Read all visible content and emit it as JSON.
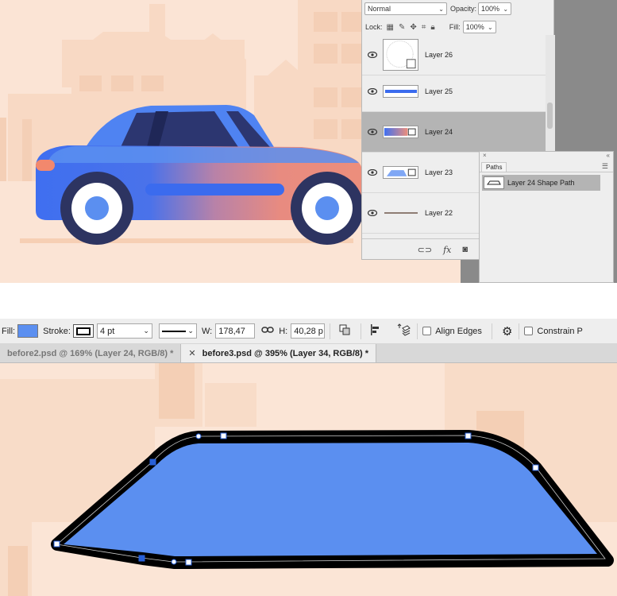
{
  "layers_panel": {
    "blend_mode": "Normal",
    "opacity_label": "Opacity:",
    "opacity_value": "100%",
    "lock_label": "Lock:",
    "fill_label": "Fill:",
    "fill_value": "100%",
    "layers": [
      {
        "name": "Layer 26",
        "selected": false
      },
      {
        "name": "Layer 25",
        "selected": false
      },
      {
        "name": "Layer 24",
        "selected": true
      },
      {
        "name": "Layer 23",
        "selected": false
      },
      {
        "name": "Layer 22",
        "selected": false
      }
    ],
    "footer_icons": [
      "link-icon",
      "fx-icon",
      "mask-icon"
    ],
    "fx_label": "fx"
  },
  "paths_panel": {
    "close_glyph": "×",
    "collapse_glyph": "«",
    "tab_label": "Paths",
    "items": [
      {
        "name": "Layer 24 Shape Path"
      }
    ]
  },
  "options_bar": {
    "fill_label": "Fill:",
    "fill_color": "#5b8ff0",
    "stroke_label": "Stroke:",
    "stroke_width": "4 pt",
    "w_label": "W:",
    "w_value": "178,47",
    "h_label": "H:",
    "h_value": "40,28 p",
    "align_edges_label": "Align Edges",
    "constrain_label": "Constrain P"
  },
  "doc_tabs": [
    {
      "title": "before2.psd @ 169% (Layer 24, RGB/8) *",
      "active": false
    },
    {
      "title": "before3.psd @ 395% (Layer 34, RGB/8) *",
      "active": true
    }
  ],
  "colors": {
    "canvas_bg": "#fbe4d5",
    "car_blue": "#3f6ff0",
    "car_window": "#2c3670",
    "wheel": "#2d3461",
    "shape_fill": "#5b8ff0",
    "panel_bg": "#eeeeee",
    "selected_row": "#b4b4b4"
  }
}
